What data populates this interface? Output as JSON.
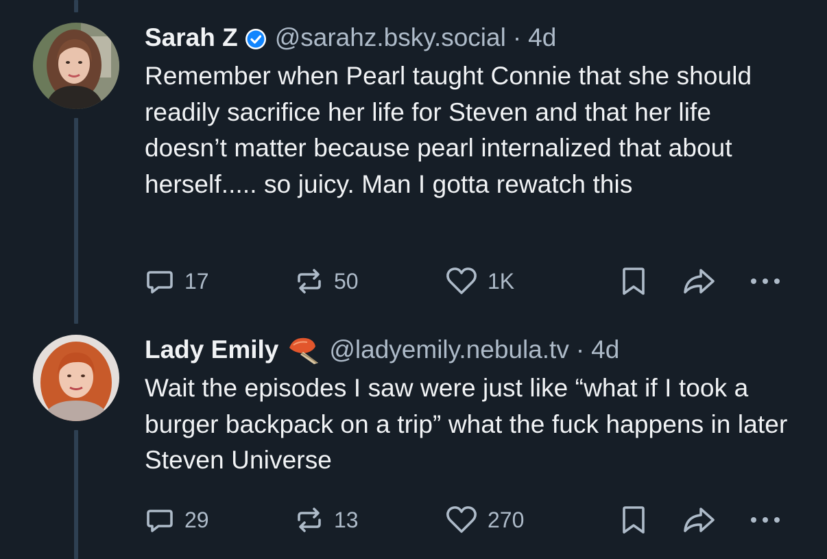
{
  "colors": {
    "background": "#161e27",
    "text": "#f1f3f5",
    "muted": "#aebbc9",
    "thread_line": "#2e4052",
    "verified": "#1185fe"
  },
  "posts": [
    {
      "display_name": "Sarah Z",
      "verified": true,
      "handle": "@sarahz.bsky.social",
      "separator": "·",
      "time": "4d",
      "text": "Remember when Pearl taught Connie that she should readily sacrifice her life for Steven and that her life doesn’t matter because pearl internalized that about herself..... so juicy. Man I gotta rewatch this",
      "replies": "17",
      "reposts": "50",
      "likes": "1K",
      "icons": [
        "reply-icon",
        "repost-icon",
        "like-icon",
        "bookmark-icon",
        "share-icon",
        "more-icon"
      ]
    },
    {
      "display_name": "Lady Emily",
      "name_emoji": "burger-shell-emoji-icon",
      "handle": "@ladyemily.nebula.tv",
      "separator": "·",
      "time": "4d",
      "text": "Wait the episodes I saw were just like “what if I took a burger backpack on a trip” what the fuck happens in later Steven Universe",
      "replies": "29",
      "reposts": "13",
      "likes": "270",
      "icons": [
        "reply-icon",
        "repost-icon",
        "like-icon",
        "bookmark-icon",
        "share-icon",
        "more-icon"
      ]
    }
  ]
}
